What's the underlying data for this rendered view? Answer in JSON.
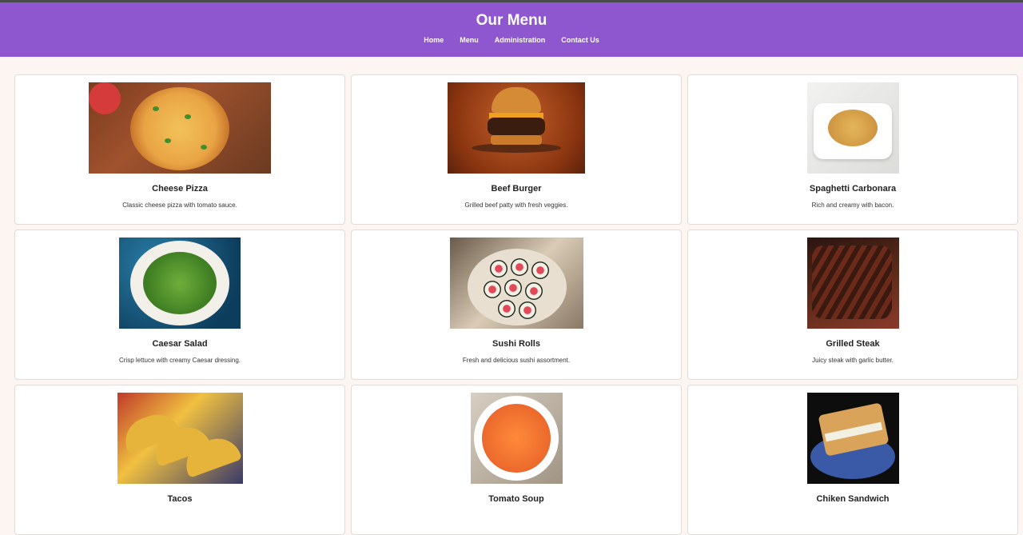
{
  "header": {
    "title": "Our Menu",
    "nav": [
      "Home",
      "Menu",
      "Administration",
      "Contact Us"
    ]
  },
  "colors": {
    "header_bg": "#8e56cf",
    "page_bg": "#fdf5f1"
  },
  "menu_items": [
    {
      "name": "Cheese Pizza",
      "description": "Classic cheese pizza with tomato sauce.",
      "image": "pizza-photo"
    },
    {
      "name": "Beef Burger",
      "description": "Grilled beef patty with fresh veggies.",
      "image": "burger-photo"
    },
    {
      "name": "Spaghetti Carbonara",
      "description": "Rich and creamy with bacon.",
      "image": "carbonara-photo"
    },
    {
      "name": "Caesar Salad",
      "description": "Crisp lettuce with creamy Caesar dressing.",
      "image": "salad-photo"
    },
    {
      "name": "Sushi Rolls",
      "description": "Fresh and delicious sushi assortment.",
      "image": "sushi-photo"
    },
    {
      "name": "Grilled Steak",
      "description": "Juicy steak with garlic butter.",
      "image": "steak-photo"
    },
    {
      "name": "Tacos",
      "description": "",
      "image": "tacos-photo"
    },
    {
      "name": "Tomato Soup",
      "description": "",
      "image": "soup-photo"
    },
    {
      "name": "Chiken Sandwich",
      "description": "",
      "image": "sandwich-photo"
    }
  ]
}
